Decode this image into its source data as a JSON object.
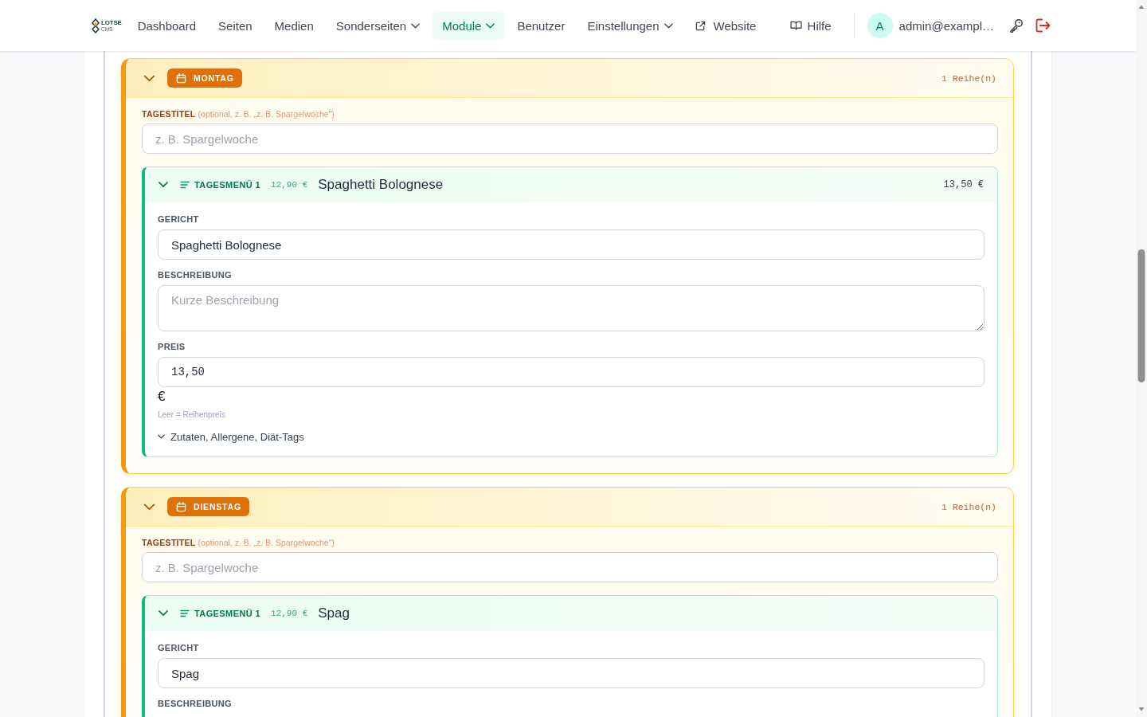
{
  "nav": {
    "logo": {
      "name": "LOTSE",
      "sub": "CMS"
    },
    "items": [
      {
        "label": "Dashboard",
        "kind": "link",
        "selected": false
      },
      {
        "label": "Seiten",
        "kind": "link",
        "selected": false
      },
      {
        "label": "Medien",
        "kind": "link",
        "selected": false
      },
      {
        "label": "Sonderseiten",
        "kind": "dropdown",
        "selected": false
      },
      {
        "label": "Module",
        "kind": "dropdown",
        "selected": true
      },
      {
        "label": "Benutzer",
        "kind": "link",
        "selected": false
      },
      {
        "label": "Einstellungen",
        "kind": "dropdown",
        "selected": false
      },
      {
        "label": "Website",
        "kind": "external",
        "selected": false
      }
    ],
    "help": {
      "label": "Hilfe"
    },
    "user": {
      "initial": "A",
      "email": "admin@exampl…"
    }
  },
  "days": [
    {
      "day": "MONTAG",
      "expanded": true,
      "rows_count": "1 Reihe(n)",
      "title_label": "TAGESTITEL",
      "title_hint": "(optional, z. B. „z. B. Spargelwoche\")",
      "title_placeholder": "z. B. Spargelwoche",
      "menus": [
        {
          "label": "TAGESMENÜ 1",
          "base_price": "12,90 €",
          "name": "Spaghetti Bolognese",
          "price": "13,50 €",
          "expanded": true,
          "fields": [
            {
              "kind": "text",
              "label": "GERICHT",
              "value": "Spaghetti Bolognese"
            },
            {
              "kind": "textarea",
              "label": "BESCHREIBUNG",
              "placeholder": "Kurze Beschreibung"
            },
            {
              "kind": "price",
              "label": "PREIS",
              "value": "13,50",
              "unit": "€",
              "hint": "Leer = Reihenpreis"
            }
          ],
          "details": {
            "label": "Zutaten, Allergene, Diät-Tags"
          }
        }
      ]
    },
    {
      "day": "DIENSTAG",
      "expanded": true,
      "rows_count": "1 Reihe(n)",
      "title_label": "TAGESTITEL",
      "title_hint": "(optional, z. B. „z. B. Spargelwoche\")",
      "title_placeholder": "z. B. Spargelwoche",
      "menus": [
        {
          "label": "TAGESMENÜ 1",
          "base_price": "12,90 €",
          "name": "Spag",
          "expanded": true,
          "fields": [
            {
              "kind": "text",
              "label": "GERICHT",
              "value": "Spag"
            },
            {
              "kind": "label_only",
              "label": "BESCHREIBUNG"
            }
          ]
        }
      ]
    }
  ]
}
